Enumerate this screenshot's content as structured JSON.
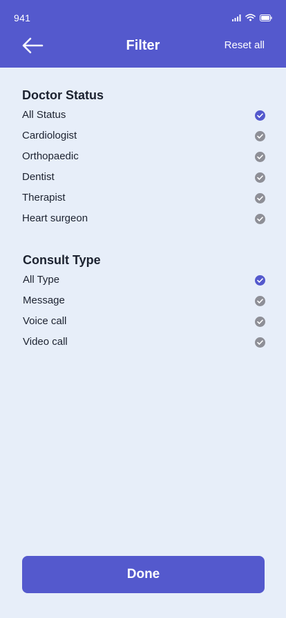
{
  "status_bar": {
    "time": "941"
  },
  "header": {
    "title": "Filter",
    "reset_label": "Reset all"
  },
  "doctor_status": {
    "title": "Doctor Status",
    "options": [
      {
        "label": "All Status",
        "selected": true
      },
      {
        "label": "Cardiologist",
        "selected": false
      },
      {
        "label": "Orthopaedic",
        "selected": false
      },
      {
        "label": "Dentist",
        "selected": false
      },
      {
        "label": "Therapist",
        "selected": false
      },
      {
        "label": "Heart surgeon",
        "selected": false
      }
    ]
  },
  "consult_type": {
    "title": "Consult Type",
    "options": [
      {
        "label": "All Type",
        "selected": true
      },
      {
        "label": "Message",
        "selected": false
      },
      {
        "label": "Voice call",
        "selected": false
      },
      {
        "label": "Video call",
        "selected": false
      }
    ]
  },
  "footer": {
    "done_label": "Done"
  },
  "colors": {
    "accent": "#5459cd",
    "background": "#e7eef9",
    "unchecked": "#8e8f97",
    "text": "#1c2230"
  },
  "icons": {
    "back": "arrow-left-icon",
    "check": "check-circle-icon"
  }
}
